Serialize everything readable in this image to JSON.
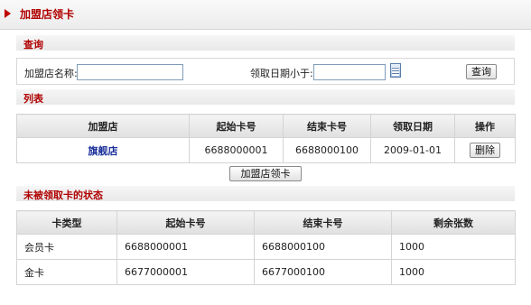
{
  "header": {
    "title": "加盟店领卡"
  },
  "query": {
    "section_title": "查询",
    "store_name_label": "加盟店名称:",
    "store_name_value": "",
    "date_label": "领取日期小于:",
    "date_value": "",
    "search_button": "查询"
  },
  "list": {
    "section_title": "列表",
    "columns": [
      "加盟店",
      "起始卡号",
      "结束卡号",
      "领取日期",
      "操作"
    ],
    "rows": [
      {
        "store": "旗舰店",
        "start": "6688000001",
        "end": "6688000100",
        "date": "2009-01-01",
        "action": "删除"
      }
    ],
    "receive_button": "加盟店领卡"
  },
  "status": {
    "section_title": "未被领取卡的状态",
    "columns": [
      "卡类型",
      "起始卡号",
      "结束卡号",
      "剩余张数"
    ],
    "rows": [
      {
        "type": "会员卡",
        "start": "6688000001",
        "end": "6688000100",
        "remaining": "1000"
      },
      {
        "type": "金卡",
        "start": "6677000001",
        "end": "6677000100",
        "remaining": "1000"
      }
    ]
  },
  "colors": {
    "accent": "#b00000",
    "link": "#1b2f9a",
    "border": "#d4d4d4"
  }
}
